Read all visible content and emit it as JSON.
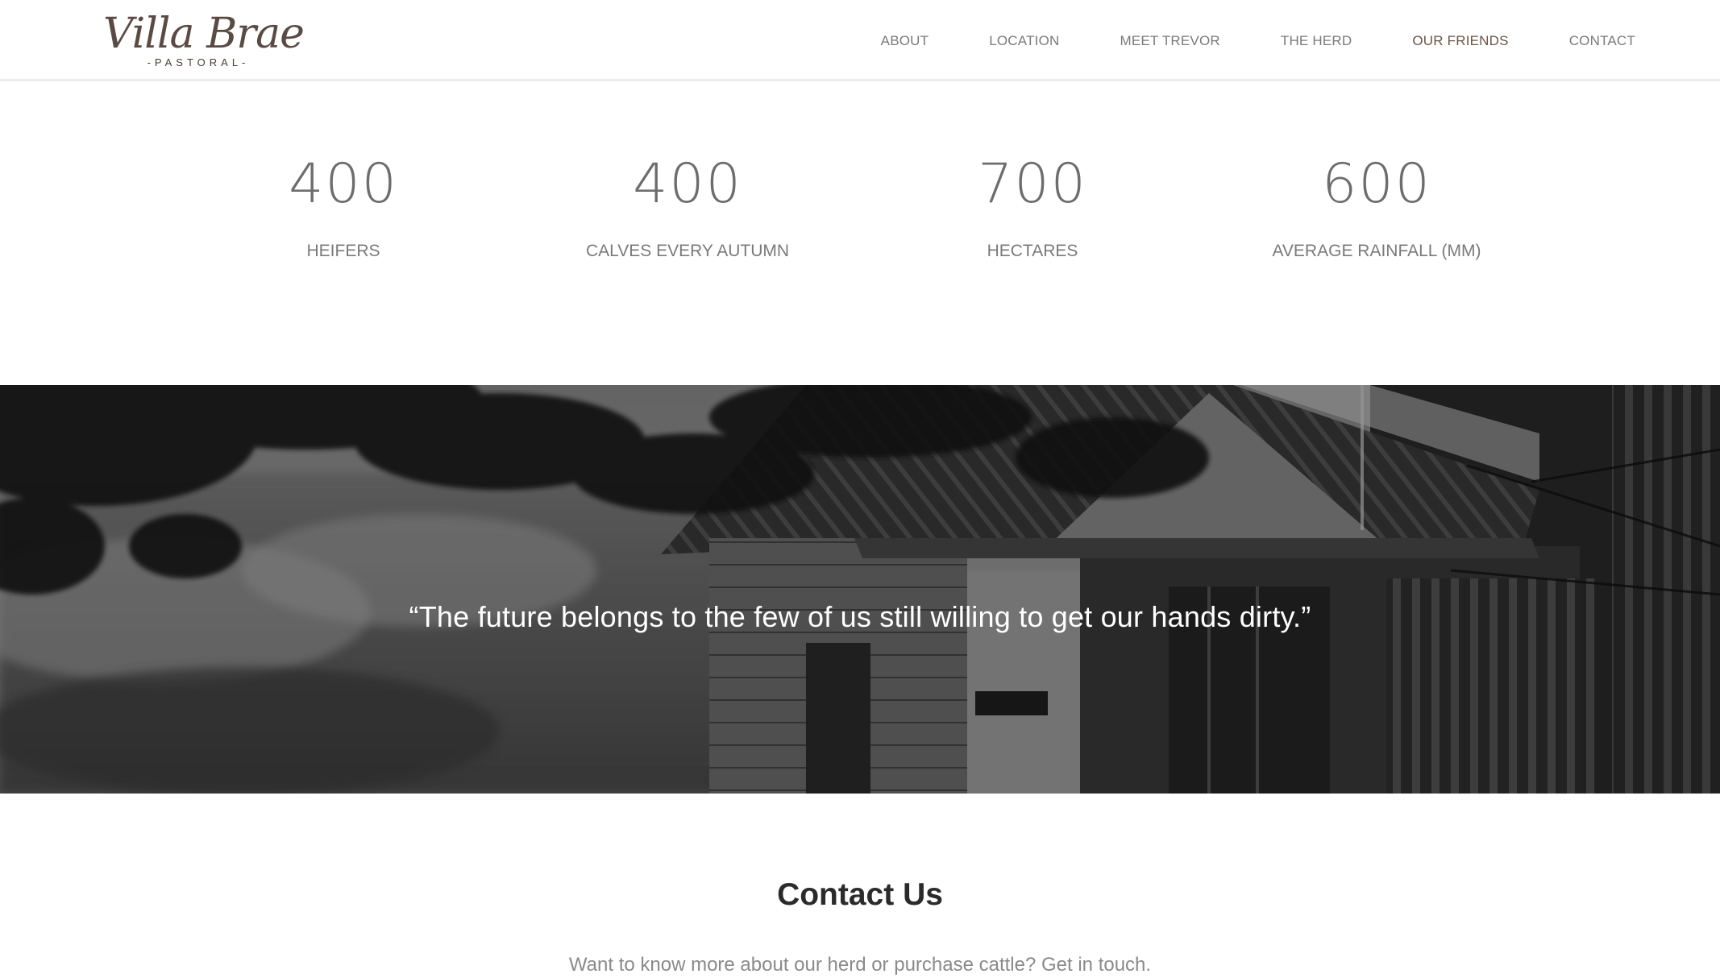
{
  "brand": {
    "name": "Villa Brae",
    "tagline": "-PASTORAL-"
  },
  "nav": {
    "items": [
      {
        "label": "ABOUT"
      },
      {
        "label": "LOCATION"
      },
      {
        "label": "MEET TREVOR"
      },
      {
        "label": "THE HERD"
      },
      {
        "label": "OUR FRIENDS",
        "active": true
      },
      {
        "label": "CONTACT"
      }
    ]
  },
  "stats": [
    {
      "value": "400",
      "label": "HEIFERS"
    },
    {
      "value": "400",
      "label": "CALVES EVERY AUTUMN"
    },
    {
      "value": "700",
      "label": "HECTARES"
    },
    {
      "value": "600",
      "label": "AVERAGE RAINFALL (MM)"
    }
  ],
  "banner": {
    "quote": "“The future belongs to the few of us still willing to get our hands dirty.”"
  },
  "contact": {
    "title": "Contact Us",
    "text": "Want to know more about our herd or purchase cattle? Get in touch."
  },
  "colors": {
    "accent": "#6b5448",
    "logo": "#5a4a44",
    "text": "#6d6d6d",
    "heading": "#2b2b2b"
  }
}
